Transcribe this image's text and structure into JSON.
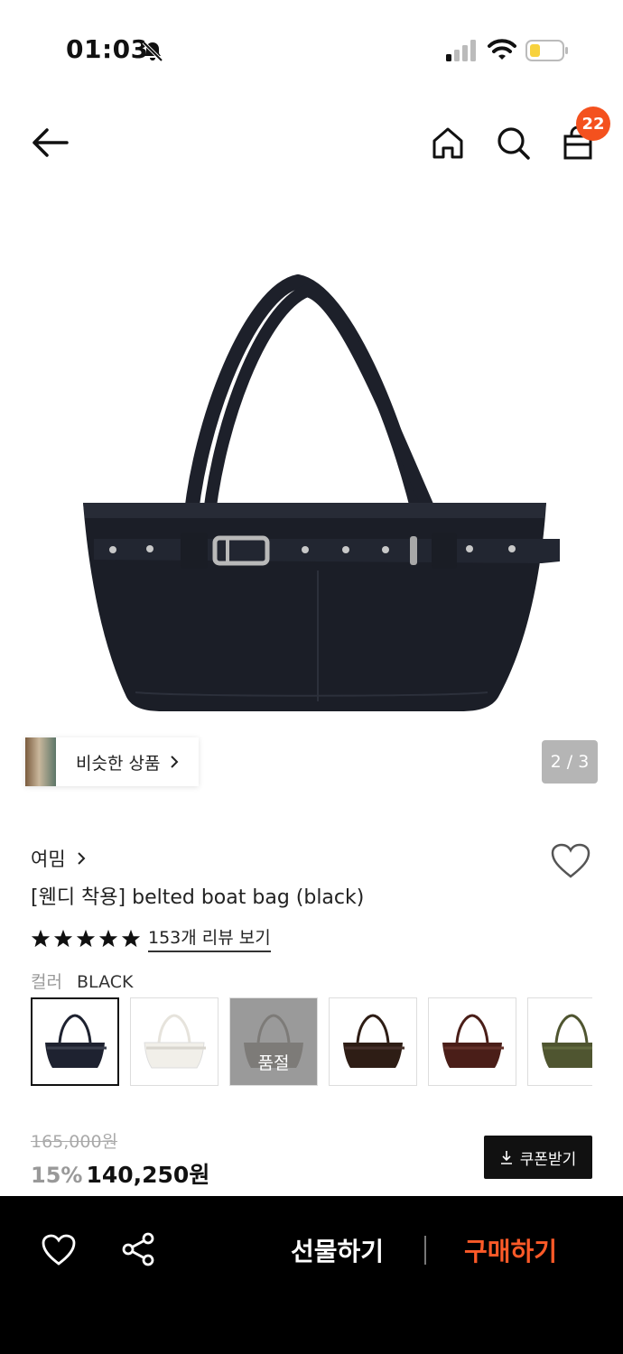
{
  "status_bar": {
    "time": "01:03",
    "icons": [
      "bell-off-icon",
      "signal-icon",
      "wifi-icon",
      "battery-icon"
    ]
  },
  "top_nav": {
    "icons": [
      "back-arrow-icon",
      "home-icon",
      "search-icon",
      "shopping-bag-icon"
    ],
    "cart_count": "22",
    "badge_color": "#f4511e"
  },
  "gallery": {
    "similar_label": "비슷한 상품",
    "counter": "2 / 3"
  },
  "product": {
    "brand": "여밈",
    "title": "[웬디 착용] belted boat bag (black)",
    "rating_stars": 5,
    "reviews_label": "153개 리뷰 보기",
    "color_label": "컬러",
    "color_value": "BLACK",
    "swatches": [
      {
        "color": "#1e2230",
        "selected": true,
        "soldout": false
      },
      {
        "color": "#f1efe9",
        "selected": false,
        "soldout": false
      },
      {
        "color": "#8c8478",
        "selected": false,
        "soldout": true,
        "soldout_label": "품절"
      },
      {
        "color": "#2e1d15",
        "selected": false,
        "soldout": false
      },
      {
        "color": "#4a1e18",
        "selected": false,
        "soldout": false
      },
      {
        "color": "#4f5530",
        "selected": false,
        "soldout": false
      }
    ]
  },
  "price": {
    "original": "165,000원",
    "discount": "15%",
    "current": "140,250원",
    "coupon_label": "쿠폰받기"
  },
  "bottom_bar": {
    "gift_label": "선물하기",
    "buy_label": "구매하기",
    "buy_color": "#ff5a28"
  }
}
